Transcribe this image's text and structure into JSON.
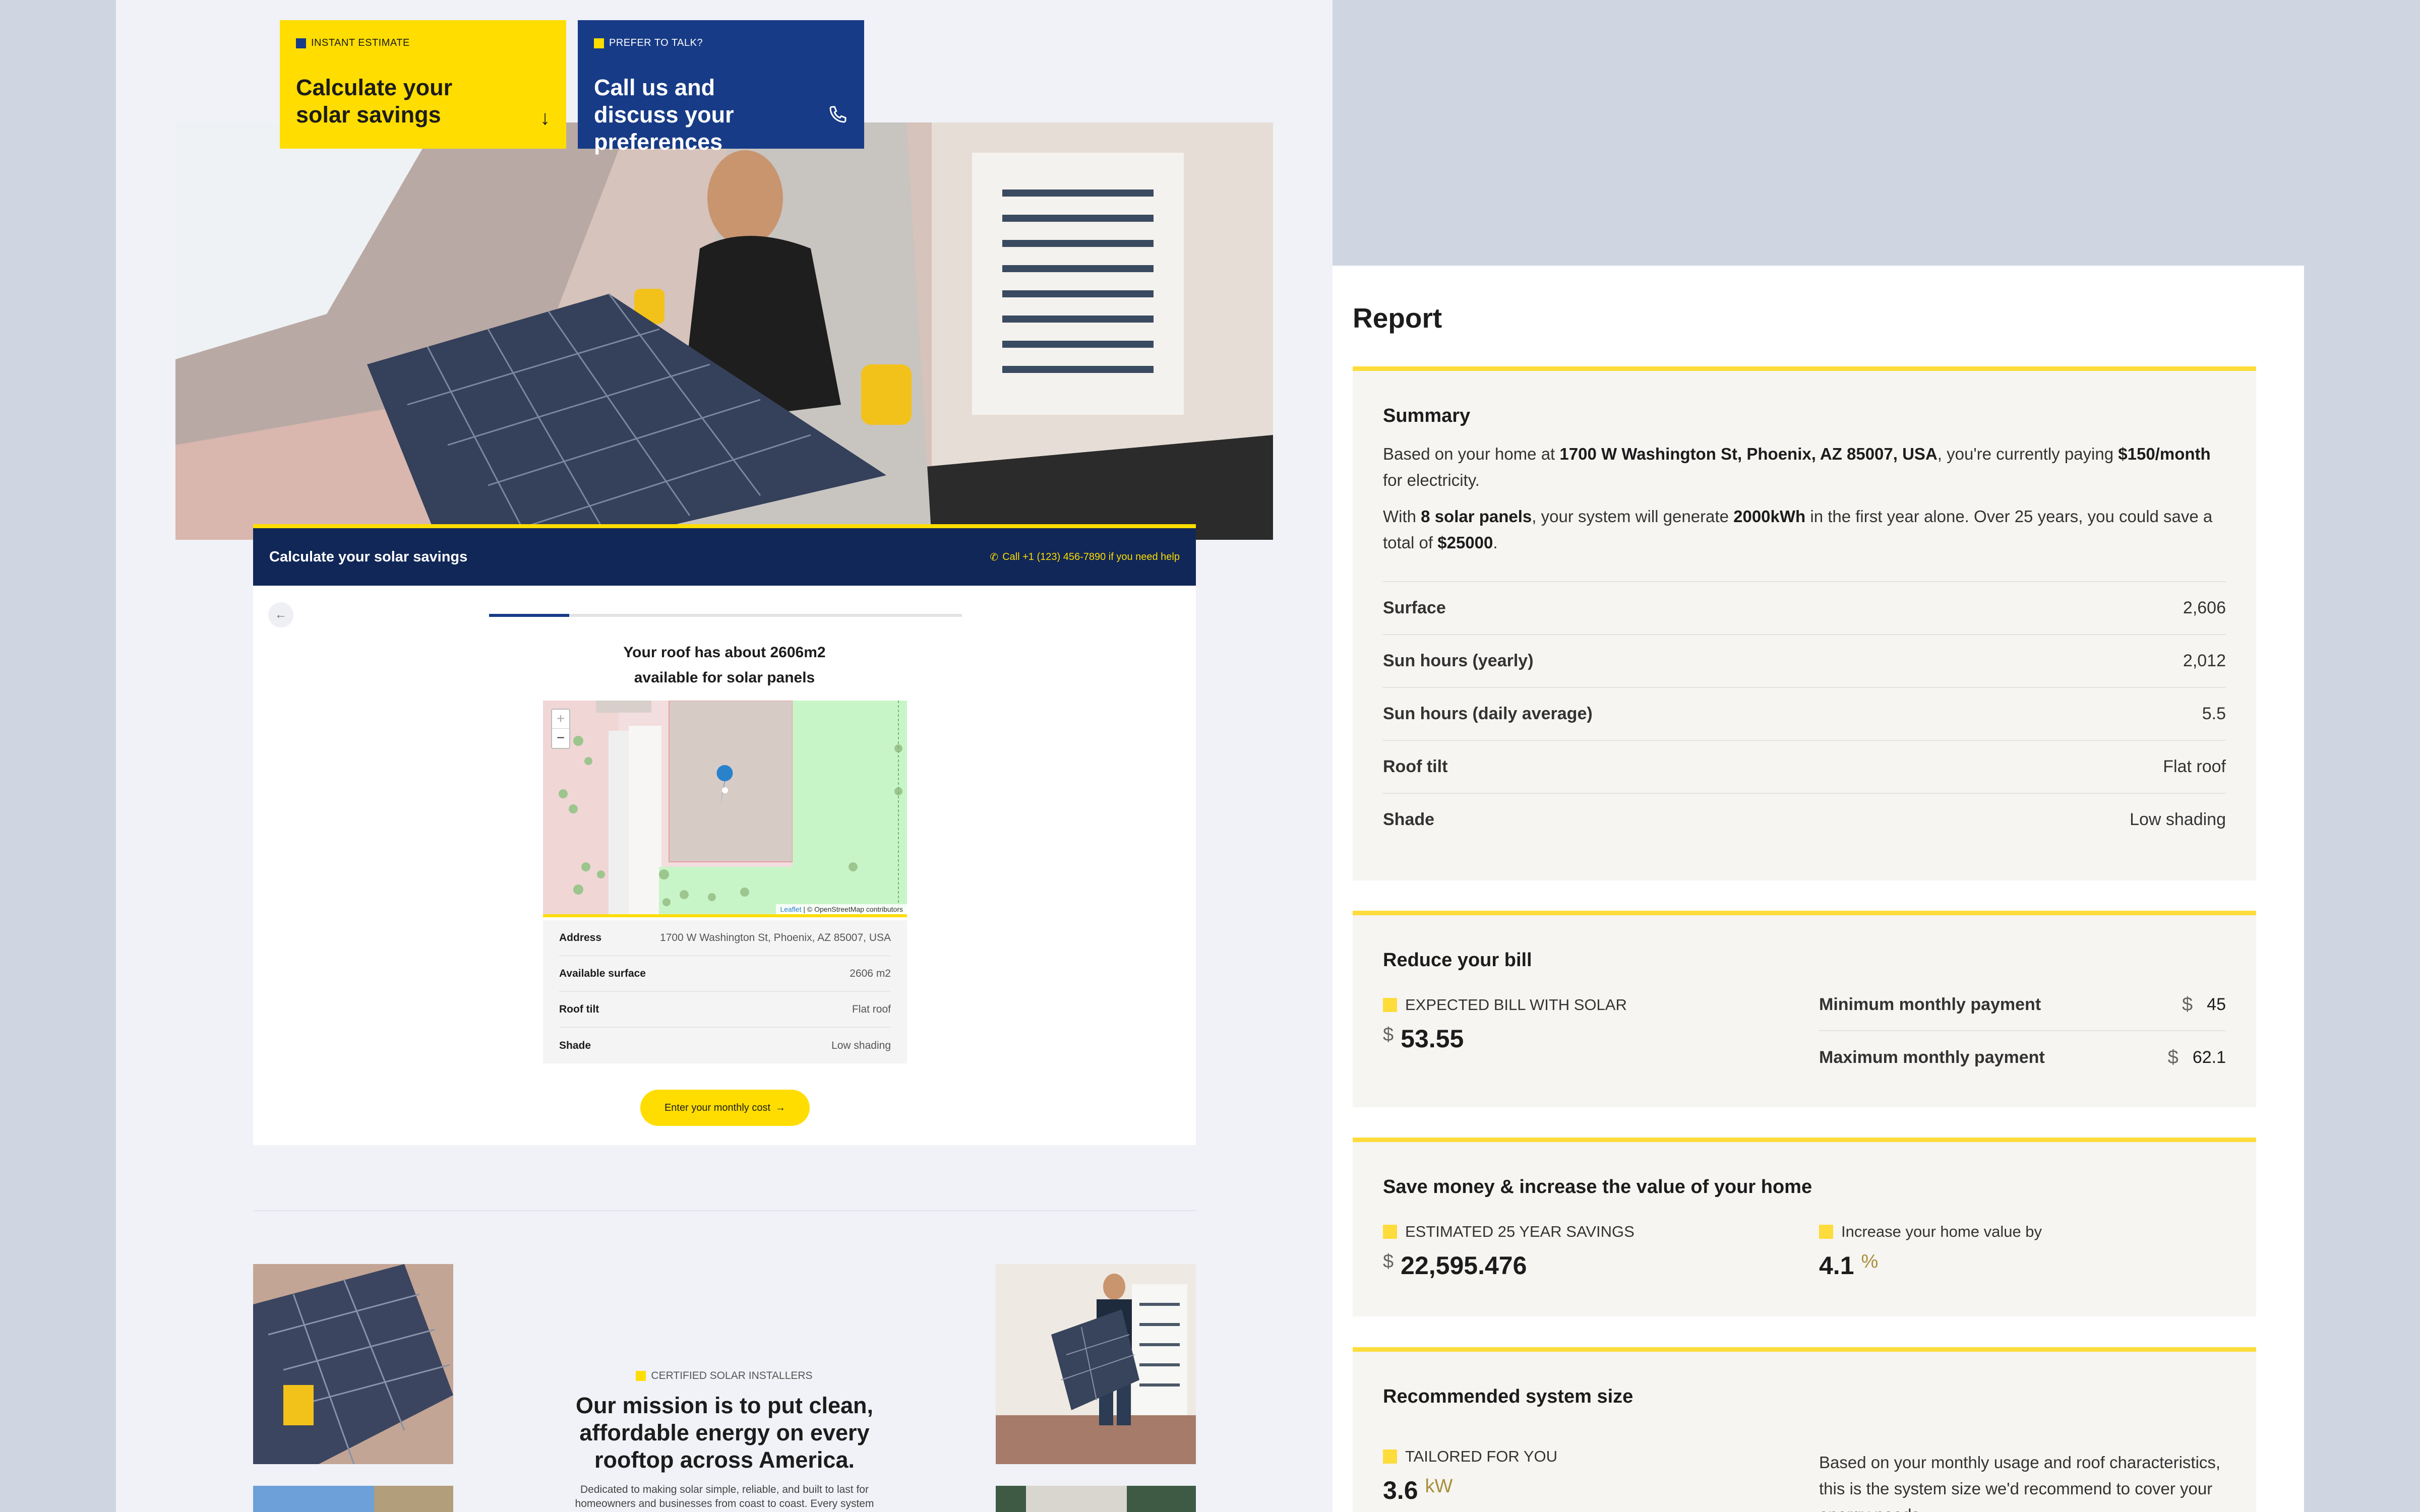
{
  "ctas": {
    "estimate": {
      "tag": "INSTANT ESTIMATE",
      "title": "Calculate your solar savings",
      "icon": "arrow-down-icon"
    },
    "talk": {
      "tag": "PREFER TO TALK?",
      "title": "Call us and discuss your preferences",
      "icon": "phone-icon"
    }
  },
  "calculator": {
    "header_title": "Calculate your solar savings",
    "help_text": "Call +1 (123) 456-7890 if you need help",
    "back_icon": "←",
    "progress": 0.17,
    "roof_line1": "Your roof has about 2606m2",
    "roof_line2": "available for solar panels",
    "map": {
      "zoom_in": "+",
      "zoom_out": "−",
      "attribution_leaflet": "Leaflet",
      "attribution_rest": " | © OpenStreetMap contributors"
    },
    "table": [
      {
        "key": "Address",
        "value": "1700 W Washington St, Phoenix, AZ 85007, USA"
      },
      {
        "key": "Available surface",
        "value": "2606 m2"
      },
      {
        "key": "Roof tilt",
        "value": "Flat roof"
      },
      {
        "key": "Shade",
        "value": "Low shading"
      }
    ],
    "cta_label": "Enter your monthly cost",
    "cta_arrow": "→"
  },
  "mission": {
    "tag": "CERTIFIED SOLAR INSTALLERS",
    "title": "Our mission is to put clean, affordable energy on every rooftop across America.",
    "body": "Dedicated to making solar simple, reliable, and built to last for homeowners and businesses from coast to coast. Every system"
  },
  "report": {
    "title": "Report",
    "summary": {
      "title": "Summary",
      "p1_a": "Based on your home at ",
      "p1_b": "1700 W Washington St, Phoenix, AZ 85007, USA",
      "p1_c": ", you're currently paying ",
      "p1_d": "$150/month",
      "p1_e": " for electricity.",
      "p2_a": "With ",
      "p2_b": "8 solar panels",
      "p2_c": ", your system will generate ",
      "p2_d": "2000kWh",
      "p2_e": " in the first year alone. Over 25 years, you could save a total of ",
      "p2_f": "$25000",
      "p2_g": ".",
      "stats": [
        {
          "key": "Surface",
          "value": "2,606"
        },
        {
          "key": "Sun hours (yearly)",
          "value": "2,012"
        },
        {
          "key": "Sun hours (daily average)",
          "value": "5.5"
        },
        {
          "key": "Roof tilt",
          "value": "Flat roof"
        },
        {
          "key": "Shade",
          "value": "Low shading"
        }
      ]
    },
    "bill": {
      "title": "Reduce your bill",
      "expected_tag": "EXPECTED BILL WITH SOLAR",
      "currency": "$",
      "expected_value": "53.55",
      "min_label": "Minimum monthly payment",
      "min_value": "45",
      "max_label": "Maximum monthly payment",
      "max_value": "62.1"
    },
    "savings": {
      "title": "Save money & increase the value of your home",
      "savings_tag": "ESTIMATED 25 YEAR SAVINGS",
      "currency": "$",
      "savings_value": "22,595.476",
      "home_tag": "Increase your home value by",
      "home_value": "4.1",
      "home_unit": "%"
    },
    "system": {
      "title": "Recommended system size",
      "tag": "TAILORED FOR YOU",
      "value": "3.6",
      "unit": "kW",
      "description": "Based on your monthly usage and roof characteristics, this is the system size we'd recommend to cover your energy needs."
    }
  },
  "colors": {
    "yellow": "#ffdd00",
    "navy": "#112757",
    "blue": "#173b86",
    "report_accent": "#fddc3b"
  }
}
